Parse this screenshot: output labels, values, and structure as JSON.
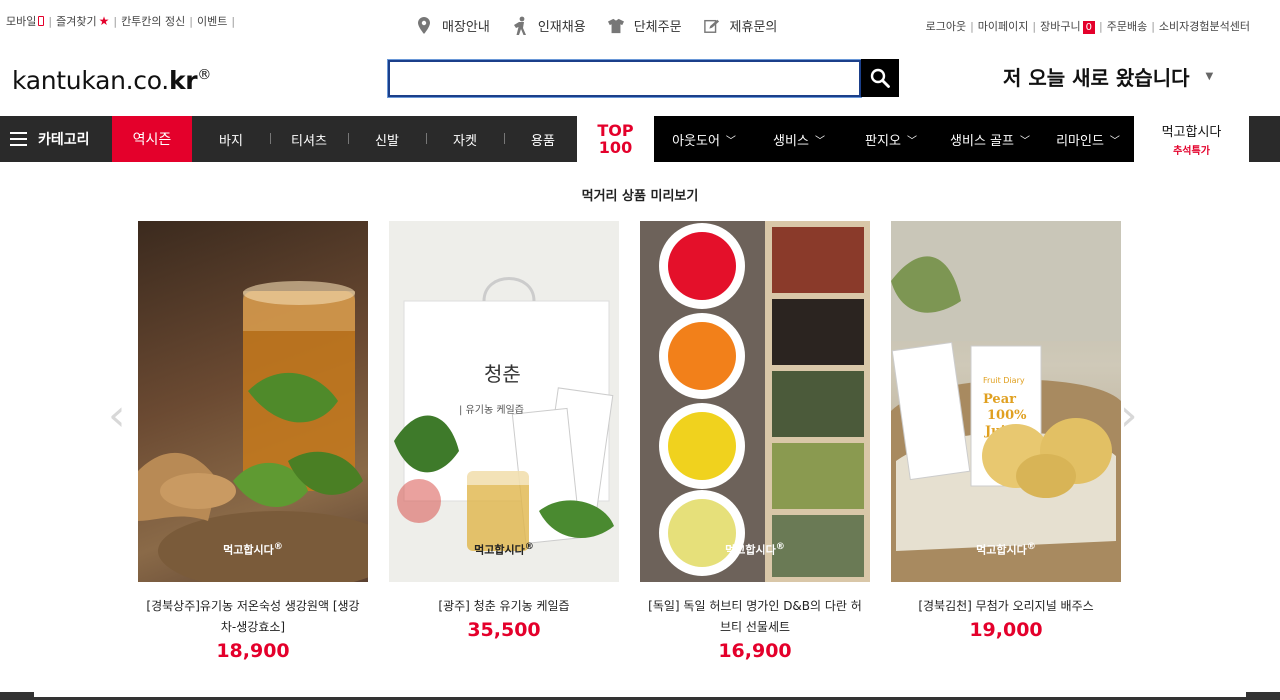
{
  "top_left": [
    "모바일",
    "즐겨찾기",
    "칸투칸의 정신",
    "이벤트"
  ],
  "top_center": [
    {
      "label": "매장안내",
      "icon": "map-pin-icon"
    },
    {
      "label": "인재채용",
      "icon": "person-icon"
    },
    {
      "label": "단체주문",
      "icon": "tshirt-icon"
    },
    {
      "label": "제휴문의",
      "icon": "document-edit-icon"
    }
  ],
  "top_right": {
    "logout": "로그아웃",
    "mypage": "마이페이지",
    "cart": "장바구니",
    "cart_count": "0",
    "orders": "주문배송",
    "consumer": "소비자경험분석센터"
  },
  "logo": {
    "text": "kantukan.co.",
    "bold": "kr",
    "reg": "®"
  },
  "search": {
    "value": ""
  },
  "promo": {
    "text": "저 오늘 새로 왔습니다",
    "caret": "▼"
  },
  "nav": {
    "category": "카테고리",
    "season": "역시즌",
    "items": [
      "바지",
      "티셔츠",
      "신발",
      "자켓",
      "용품"
    ],
    "top100": {
      "line1": "TOP",
      "line2": "100"
    },
    "black_items": [
      "아웃도어",
      "생비스",
      "판지오",
      "생비스 골프",
      "리마인드"
    ],
    "chevron": "﹀",
    "meokgo": {
      "title": "먹고합시다",
      "sub": "추석특가"
    }
  },
  "preview": {
    "title": "먹거리 상품 미리보기",
    "watermark": "먹고합시다",
    "watermark_mark": "®",
    "prev": "‹",
    "next": "›",
    "products": [
      {
        "name": "[경북상주]유기농 저온숙성 생강원액 [생강차-생강효소]",
        "price": "18,900"
      },
      {
        "name": "[광주] 청춘 유기농 케일즙",
        "price": "35,500"
      },
      {
        "name": "[독일] 독일 허브티 명가인 D&B의 다란 허브티 선물세트",
        "price": "16,900"
      },
      {
        "name": "[경북김천] 무첨가 오리지널 배주스",
        "price": "19,000"
      }
    ]
  },
  "image_text": {
    "kale_box": "청춘",
    "kale_box_sub": "| 유기농 케일즙",
    "pear_pack": [
      "Fruit Diary",
      "Pear",
      "100%",
      "Juice"
    ]
  }
}
